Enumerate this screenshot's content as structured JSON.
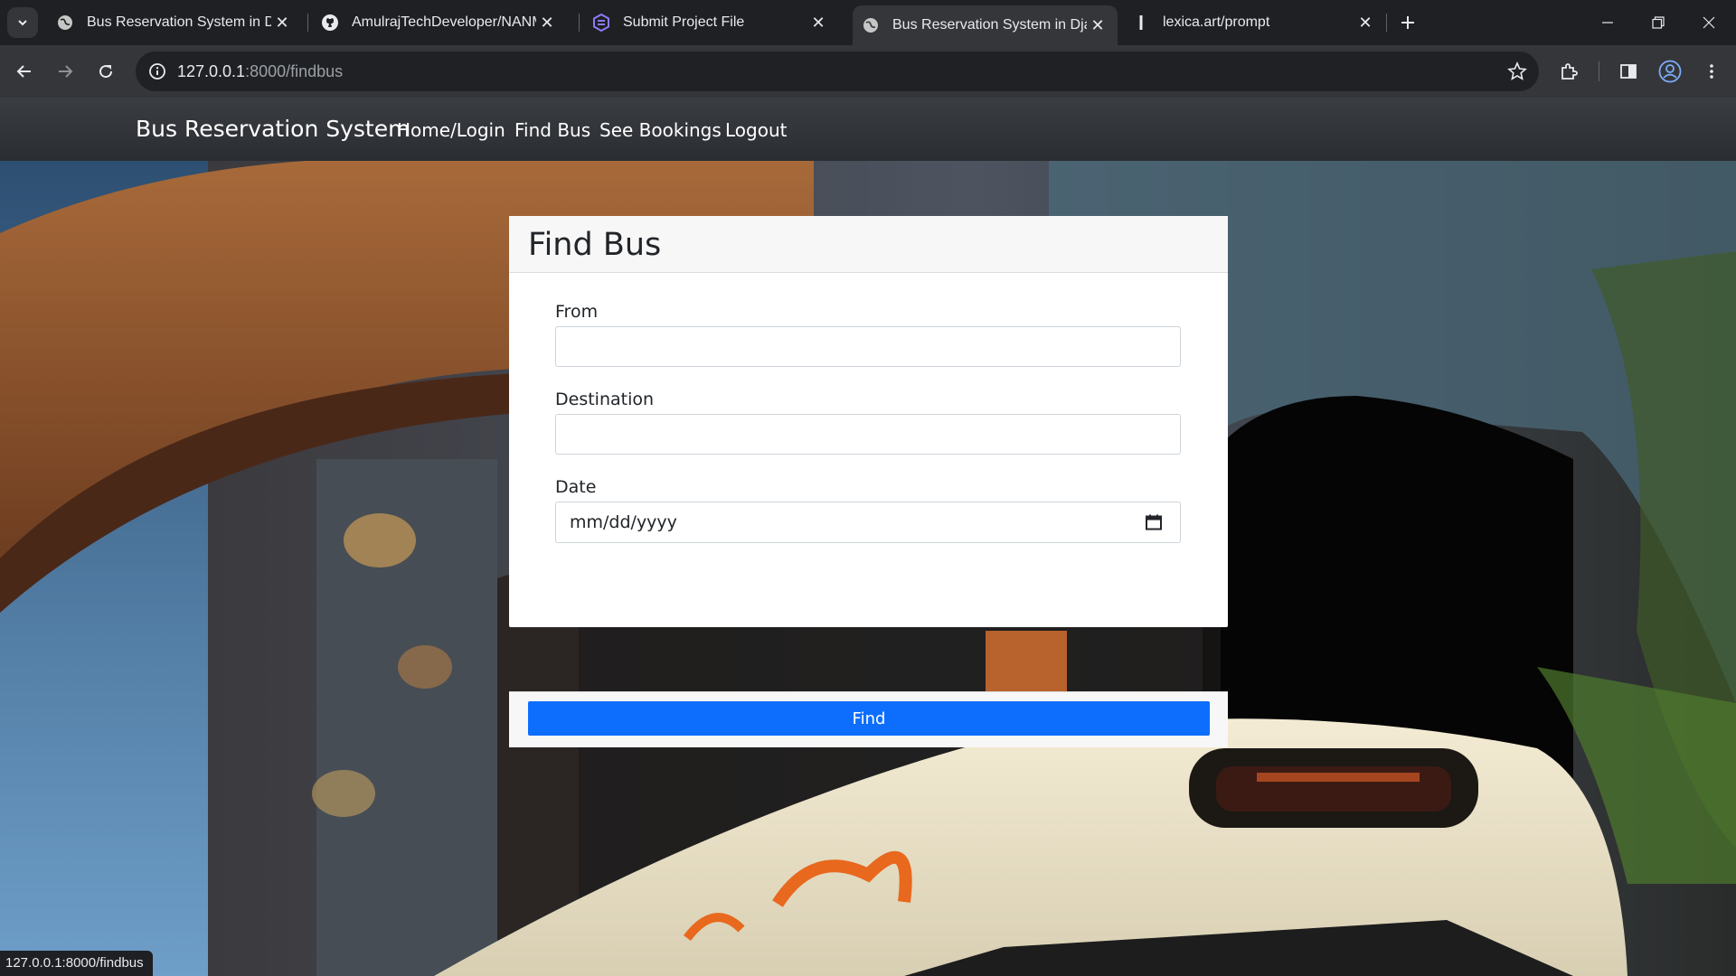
{
  "tabs": [
    {
      "title": "Bus Reservation System in Djan",
      "active": false,
      "icon": "globe-icon"
    },
    {
      "title": "AmulrajTechDeveloper/NANMU",
      "active": false,
      "icon": "github-icon"
    },
    {
      "title": "Submit Project File",
      "active": false,
      "icon": "hex-logo-icon"
    },
    {
      "title": "Bus Reservation System in Djan",
      "active": true,
      "icon": "globe-icon"
    },
    {
      "title": "lexica.art/prompt",
      "active": false,
      "icon": "lexica-icon"
    }
  ],
  "address_bar": {
    "host": "127.0.0.1",
    "path": ":8000/findbus"
  },
  "navbar": {
    "brand": "Bus Reservation System",
    "links": [
      "Home/Login",
      "Find Bus",
      "See Bookings",
      "Logout"
    ]
  },
  "form": {
    "title": "Find Bus",
    "from_label": "From",
    "from_value": "",
    "destination_label": "Destination",
    "destination_value": "",
    "date_label": "Date",
    "date_placeholder": "mm/dd/yyyy",
    "submit_label": "Find"
  },
  "status_bar": "127.0.0.1:8000/findbus",
  "colors": {
    "accent": "#0d6efd",
    "navbar": "#343a40",
    "chrome_dark": "#1f2023",
    "chrome_mid": "#35363a"
  }
}
